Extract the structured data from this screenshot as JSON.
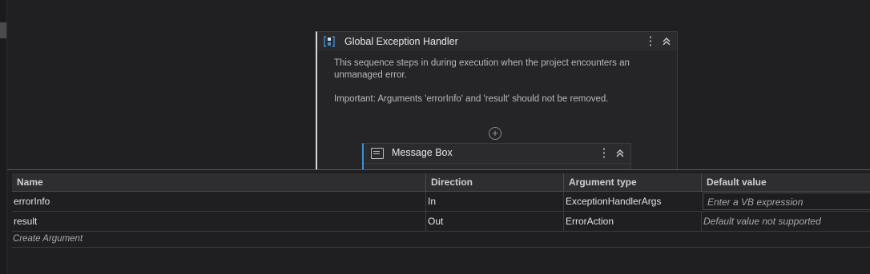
{
  "sequence": {
    "title": "Global Exception Handler",
    "description_line1": "This sequence steps in during execution when the project encounters an",
    "description_line2": "unmanaged error.",
    "important_note": "Important: Arguments 'errorInfo' and 'result' should not be removed.",
    "icon": "sequence-icon",
    "accent_color": "#3b8fd4"
  },
  "activity": {
    "title": "Message Box",
    "icon": "message-box-icon"
  },
  "arguments_panel": {
    "columns": [
      "Name",
      "Direction",
      "Argument type",
      "Default value"
    ],
    "rows": [
      {
        "name": "errorInfo",
        "direction": "In",
        "type": "ExceptionHandlerArgs",
        "default": "Enter a VB expression"
      },
      {
        "name": "result",
        "direction": "Out",
        "type": "ErrorAction",
        "default": "Default value not supported"
      }
    ],
    "create_label": "Create Argument"
  }
}
